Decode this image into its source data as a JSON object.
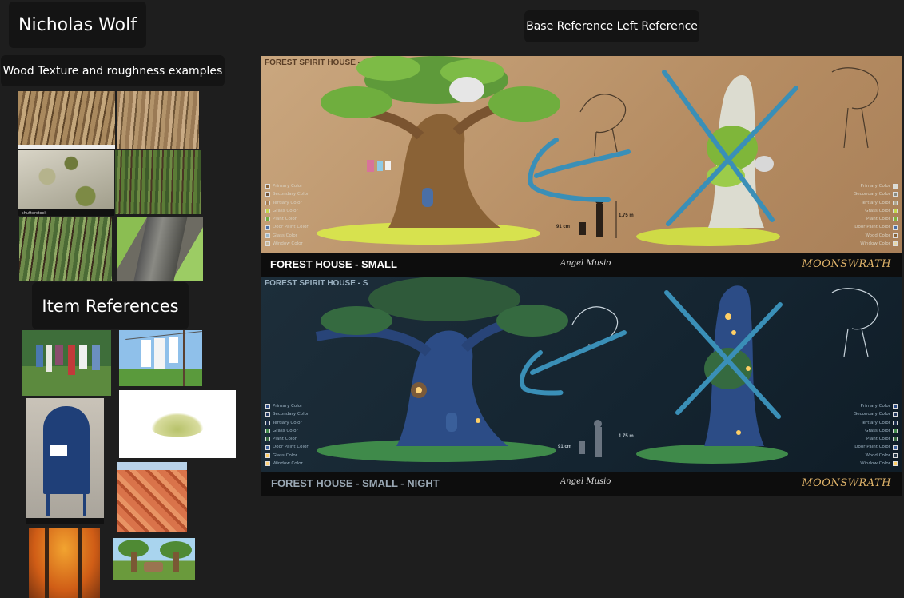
{
  "labels": {
    "name": "Nicholas Wolf",
    "wood_section": "Wood Texture and roughness examples",
    "item_section": "Item References",
    "base_reference": "Base Reference Left Reference"
  },
  "texture_caption": "shutterstock",
  "panels": {
    "day": {
      "corner_title": "FOREST SPIRIT HOUSE - S",
      "banner_title": "FOREST HOUSE - SMALL",
      "scale_cm": "91 cm",
      "scale_m": "1.75 m",
      "signature": "Angel Musio",
      "brand": "MOONSWRATH"
    },
    "night": {
      "corner_title": "FOREST SPIRIT HOUSE - S",
      "banner_title": "FOREST HOUSE - SMALL - NIGHT",
      "scale_cm": "91 cm",
      "scale_m": "1.75 m",
      "signature": "Angel Musio",
      "brand": "MOONSWRATH"
    }
  },
  "legend_left": [
    "Primary Color",
    "Secondary Color",
    "Tertiary Color",
    "Grass Color",
    "Plant Color",
    "Door Paint Color",
    "Glass Color",
    "Window Color"
  ],
  "legend_right": [
    "Primary Color",
    "Secondary Color",
    "Tertiary Color",
    "Grass Color",
    "Plant Color",
    "Door Paint Color",
    "Wood Color",
    "Window Color"
  ],
  "colors": {
    "background": "#1e1e1e",
    "label_bg": "#141414",
    "annotation_blue": "#3a8fb7",
    "brand_gold": "#e0b46a"
  }
}
